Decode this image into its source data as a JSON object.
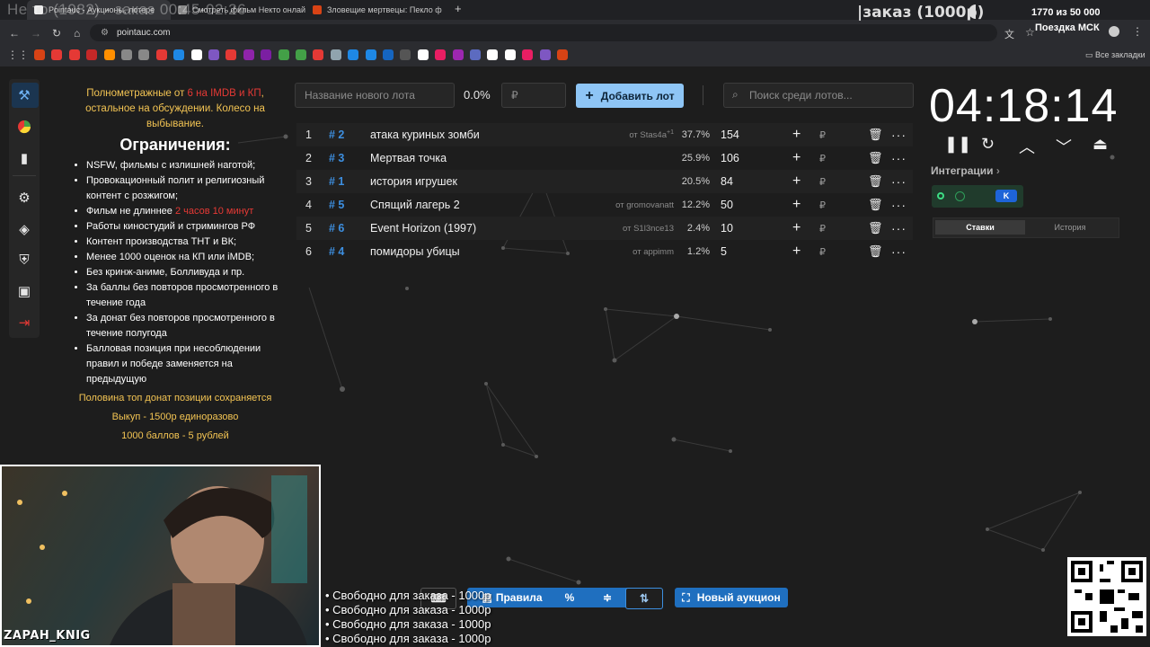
{
  "browser": {
    "tabs": [
      {
        "label": "Pointauc - Аукционы, лотере"
      },
      {
        "label": "Смотреть фильм Некто онлайн"
      },
      {
        "label": "Зловещие мертвецы: Пекло ф"
      }
    ],
    "url": "pointauc.com",
    "bookmarks_label": "Все закладки"
  },
  "overlay": {
    "title": "Не то (1982) - заказ 00:45-02:26",
    "order_label": "|заказ (1000р)",
    "counter": "1770  из 50 000",
    "trip": "Поездка МСК"
  },
  "rules": {
    "intro_pre": "Полнометражные от ",
    "intro_red": "6 на IMDB и КП",
    "intro_post": ", остальное на обсуждении. Колесо на выбывание.",
    "heading": "Ограничения:",
    "items": [
      "NSFW, фильмы с излишней наготой;",
      "Провокационный полит и религиозный контент с розжигом;",
      "Фильм не длиннее ",
      "Работы киностудий и стримингов РФ",
      "Контент производства ТНТ и ВК;",
      "Менее 1000 оценок на КП или iMDB;",
      "Без кринж-аниме, Болливуда и пр.",
      "За баллы без повторов просмотренного в течение года",
      "За донат без повторов просмотренного в течение полугода",
      "Балловая позиция при несоблюдении правил и победе заменяется на предыдущую"
    ],
    "length_red": "2 часов 10 минут",
    "footer": [
      "Половина топ донат позиции сохраняется",
      "Выкуп - 1500р единоразово",
      "1000 баллов - 5 рублей"
    ]
  },
  "lot_form": {
    "name_placeholder": "Название нового лота",
    "percent": "0.0%",
    "currency": "₽",
    "add_label": "Добавить лот",
    "search_placeholder": "Поиск среди лотов..."
  },
  "lots": [
    {
      "num": "1",
      "id": "# 2",
      "name": "атака куриных зомби",
      "author": "от Stas4a",
      "author_sup": "+1",
      "percent": "37.7%",
      "amount": "154"
    },
    {
      "num": "2",
      "id": "# 3",
      "name": "Мертвая точка",
      "author": "",
      "author_sup": "",
      "percent": "25.9%",
      "amount": "106"
    },
    {
      "num": "3",
      "id": "# 1",
      "name": "история игрушек",
      "author": "",
      "author_sup": "",
      "percent": "20.5%",
      "amount": "84"
    },
    {
      "num": "4",
      "id": "# 5",
      "name": "Спящий лагерь 2",
      "author": "от gromovanatt",
      "author_sup": "",
      "percent": "12.2%",
      "amount": "50"
    },
    {
      "num": "5",
      "id": "# 6",
      "name": "Event Horizon (1997)",
      "author": "от S1l3nce13",
      "author_sup": "",
      "percent": "2.4%",
      "amount": "10"
    },
    {
      "num": "6",
      "id": "# 4",
      "name": "помидоры убицы",
      "author": "от appimm",
      "author_sup": "",
      "percent": "1.2%",
      "amount": "5"
    }
  ],
  "right": {
    "timer": "04:18:14",
    "integrations": "Интеграции",
    "tab_bets": "Ставки",
    "tab_history": "История"
  },
  "bottom": {
    "rules": "Правила",
    "new_auction": "Новый аукцион",
    "free_lines": [
      "• Свободно для заказа - 1000р",
      "• Свободно для заказа - 1000р",
      "• Свободно для заказа - 1000р",
      "• Свободно для заказа - 1000р"
    ]
  },
  "webcam": {
    "name": "ZAPAH_KNIG"
  },
  "colors": {
    "accent": "#8ec5f5",
    "id_blue": "#3d8fe0",
    "gold": "#f3c453",
    "red": "#e53935"
  }
}
